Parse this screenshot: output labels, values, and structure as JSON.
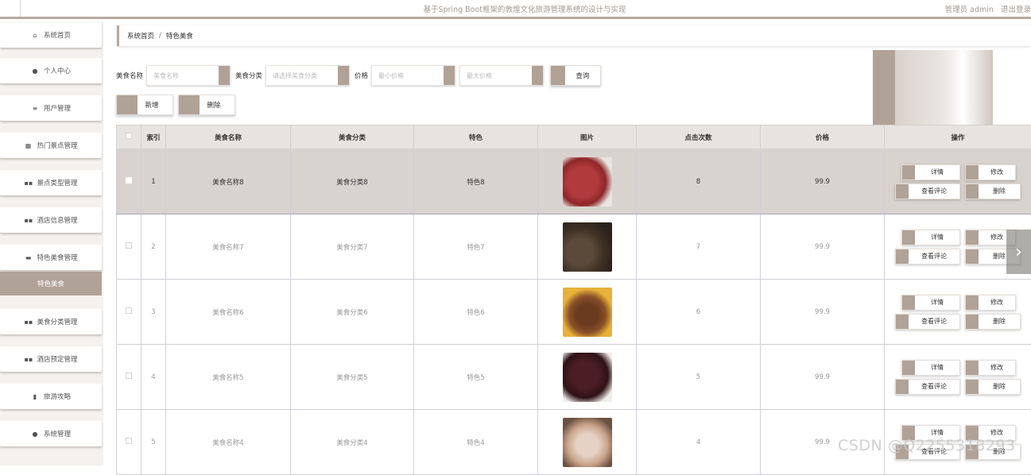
{
  "header": {
    "title": "基于Spring Boot框架的敦煌文化旅游管理系统的设计与实现",
    "user": "管理员 admin",
    "logout": "退出登录"
  },
  "sidebar": {
    "items": [
      {
        "label": "系统首页",
        "icon": "home-icon"
      },
      {
        "label": "个人中心",
        "icon": "user-icon"
      },
      {
        "label": "用户管理",
        "icon": "sliders-icon"
      },
      {
        "label": "热门景点管理",
        "icon": "grid-icon"
      },
      {
        "label": "景点类型管理",
        "icon": "apps-icon"
      },
      {
        "label": "酒店信息管理",
        "icon": "apps-icon"
      },
      {
        "label": "特色美食管理",
        "icon": "briefcase-icon"
      },
      {
        "label": "美食分类管理",
        "icon": "apps-icon"
      },
      {
        "label": "酒店预定管理",
        "icon": "apps-icon"
      },
      {
        "label": "旅游攻略",
        "icon": "clipboard-icon"
      },
      {
        "label": "系统管理",
        "icon": "location-icon"
      }
    ],
    "active_sub": "特色美食"
  },
  "breadcrumb": {
    "home": "系统首页",
    "sep": "/",
    "current": "特色美食"
  },
  "search": {
    "name_label": "美食名称",
    "name_placeholder": "美食名称",
    "category_label": "美食分类",
    "category_placeholder": "请选择美食分类",
    "price_label": "价格",
    "min_placeholder": "最小价格",
    "max_placeholder": "最大价格",
    "query_label": "查询"
  },
  "actions": {
    "add_label": "新增",
    "delete_label": "删除"
  },
  "table": {
    "headers": [
      "索引",
      "美食名称",
      "美食分类",
      "特色",
      "图片",
      "点击次数",
      "价格",
      "操作"
    ],
    "rows": [
      {
        "index": "1",
        "name": "美食名称8",
        "category": "美食分类8",
        "feature": "特色8",
        "clicks": "8",
        "price": "99.9"
      },
      {
        "index": "2",
        "name": "美食名称7",
        "category": "美食分类7",
        "feature": "特色7",
        "clicks": "7",
        "price": "99.9"
      },
      {
        "index": "3",
        "name": "美食名称6",
        "category": "美食分类6",
        "feature": "特色6",
        "clicks": "6",
        "price": "99.9"
      },
      {
        "index": "4",
        "name": "美食名称5",
        "category": "美食分类5",
        "feature": "特色5",
        "clicks": "5",
        "price": "99.9"
      },
      {
        "index": "5",
        "name": "美食名称4",
        "category": "美食分类4",
        "feature": "特色4",
        "clicks": "4",
        "price": "99.9"
      }
    ],
    "row_buttons": {
      "detail": "详情",
      "edit": "修改",
      "comments": "查看评论",
      "delete": "删除"
    }
  },
  "watermark": "CSDN @Q2255318293",
  "colors": {
    "accent": "#b1a298",
    "selected_row": "#d9d3cf",
    "header_bg": "#e7e3e0"
  }
}
